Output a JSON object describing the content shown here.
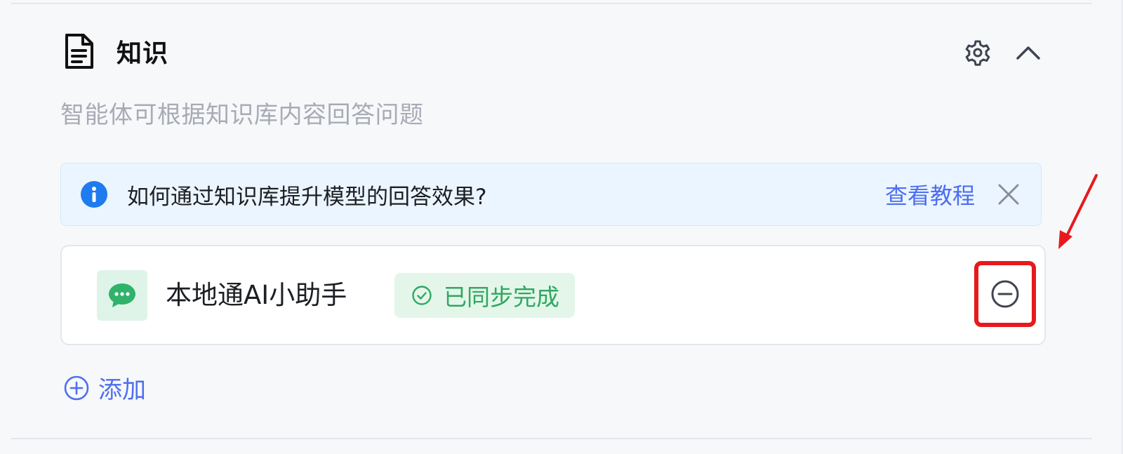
{
  "section": {
    "title": "知识",
    "description": "智能体可根据知识库内容回答问题",
    "icons": {
      "section": "document-icon",
      "settings": "gear-icon",
      "collapse": "chevron-up-icon"
    }
  },
  "banner": {
    "text": "如何通过知识库提升模型的回答效果?",
    "link_label": "查看教程",
    "icons": {
      "info": "info-icon",
      "close": "close-icon"
    }
  },
  "knowledge_items": [
    {
      "name": "本地通AI小助手",
      "status": "已同步完成",
      "icon": "chat-bubble-icon",
      "action_icon": "minus-circle-icon"
    }
  ],
  "add": {
    "label": "添加",
    "icon": "plus-circle-icon"
  },
  "colors": {
    "accent_blue": "#4d6ef2",
    "info_blue": "#1e7bf0",
    "banner_bg": "#ebf5ff",
    "success_green": "#2fa860",
    "success_bg": "#e4f6ea",
    "highlight_red": "#e8191d"
  }
}
